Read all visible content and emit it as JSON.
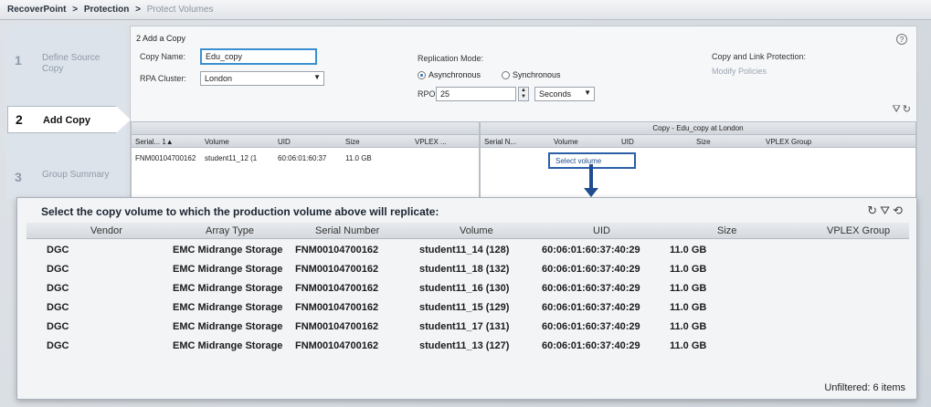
{
  "breadcrumb": [
    "RecoverPoint",
    ">",
    "Protection",
    ">",
    "Protect Volumes"
  ],
  "wizard": {
    "steps": [
      {
        "num": "1",
        "label": "Define Source Copy"
      },
      {
        "num": "2",
        "label": "Add Copy"
      },
      {
        "num": "3",
        "label": "Group Summary"
      }
    ]
  },
  "add_copy": {
    "section_title": "2 Add a Copy",
    "copy_name_label": "Copy Name:",
    "copy_name_value": "Edu_copy",
    "rpa_cluster_label": "RPA Cluster:",
    "rpa_cluster_value": "London",
    "replication_mode_label": "Replication Mode:",
    "mode_async": "Asynchronous",
    "mode_sync": "Synchronous",
    "rpo_label": "RPO:",
    "rpo_value": "25",
    "rpo_unit": "Seconds",
    "copy_link_label": "Copy and Link Protection:",
    "modify_policies": "Modify Policies"
  },
  "source_table": {
    "headers": [
      "Serial... 1▲",
      "Volume",
      "UID",
      "Size",
      "VPLEX ..."
    ],
    "row": [
      "FNM00104700162",
      "student11_12 (1",
      "60:06:01:60:37",
      "11.0 GB"
    ]
  },
  "copy_table": {
    "caption": "Copy - Edu_copy at London",
    "headers": [
      "Serial N...",
      "Volume",
      "UID",
      "Size",
      "VPLEX Group"
    ],
    "select_volume": "Select volume"
  },
  "dialog": {
    "title": "Select the copy volume to which the production volume above will replicate:",
    "headers": [
      "Vendor",
      "Array Type",
      "Serial Number",
      "Volume",
      "UID",
      "Size",
      "VPLEX Group"
    ],
    "rows": [
      [
        "DGC",
        "EMC Midrange Storage",
        "FNM00104700162",
        "student11_14 (128)",
        "60:06:01:60:37:40:29",
        "11.0 GB"
      ],
      [
        "DGC",
        "EMC Midrange Storage",
        "FNM00104700162",
        "student11_18 (132)",
        "60:06:01:60:37:40:29",
        "11.0 GB"
      ],
      [
        "DGC",
        "EMC Midrange Storage",
        "FNM00104700162",
        "student11_16 (130)",
        "60:06:01:60:37:40:29",
        "11.0 GB"
      ],
      [
        "DGC",
        "EMC Midrange Storage",
        "FNM00104700162",
        "student11_15 (129)",
        "60:06:01:60:37:40:29",
        "11.0 GB"
      ],
      [
        "DGC",
        "EMC Midrange Storage",
        "FNM00104700162",
        "student11_17 (131)",
        "60:06:01:60:37:40:29",
        "11.0 GB"
      ],
      [
        "DGC",
        "EMC Midrange Storage",
        "FNM00104700162",
        "student11_13 (127)",
        "60:06:01:60:37:40:29",
        "11.0 GB"
      ]
    ],
    "footer": "Unfiltered: 6 items"
  }
}
